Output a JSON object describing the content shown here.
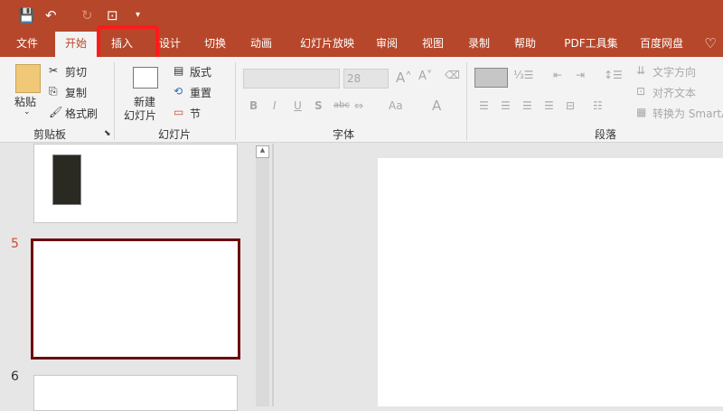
{
  "quick_access": {
    "save": "save-icon",
    "undo": "undo-icon",
    "redo": "redo-icon",
    "present": "present-icon",
    "more": "▾"
  },
  "tabs": [
    "文件",
    "开始",
    "插入",
    "设计",
    "切换",
    "动画",
    "幻灯片放映",
    "审阅",
    "视图",
    "录制",
    "帮助",
    "PDF工具集",
    "百度网盘"
  ],
  "active_tab": "开始",
  "highlighted_tab": "插入",
  "clipboard": {
    "paste": "粘贴",
    "cut": "剪切",
    "copy": "复制",
    "format_painter": "格式刷",
    "group": "剪贴板"
  },
  "slides_group": {
    "new_slide_line1": "新建",
    "new_slide_line2": "幻灯片",
    "layout": "版式",
    "reset": "重置",
    "section": "节",
    "group": "幻灯片"
  },
  "font": {
    "font_name": "",
    "font_size": "28",
    "bold": "B",
    "italic": "I",
    "underline": "U",
    "shadow": "S",
    "strike": "abc",
    "case": "Aa",
    "color": "A",
    "group": "字体"
  },
  "paragraph": {
    "text_direction": "文字方向",
    "align_text": "对齐文本",
    "smartart": "转换为 SmartArt",
    "group": "段落"
  },
  "thumbnails": [
    {
      "number": "5",
      "selected": true
    },
    {
      "number": "6",
      "selected": false
    }
  ],
  "colors": {
    "accent": "#b7472a",
    "selected_border": "#6e0a0f",
    "highlight": "#ff1a1a"
  }
}
